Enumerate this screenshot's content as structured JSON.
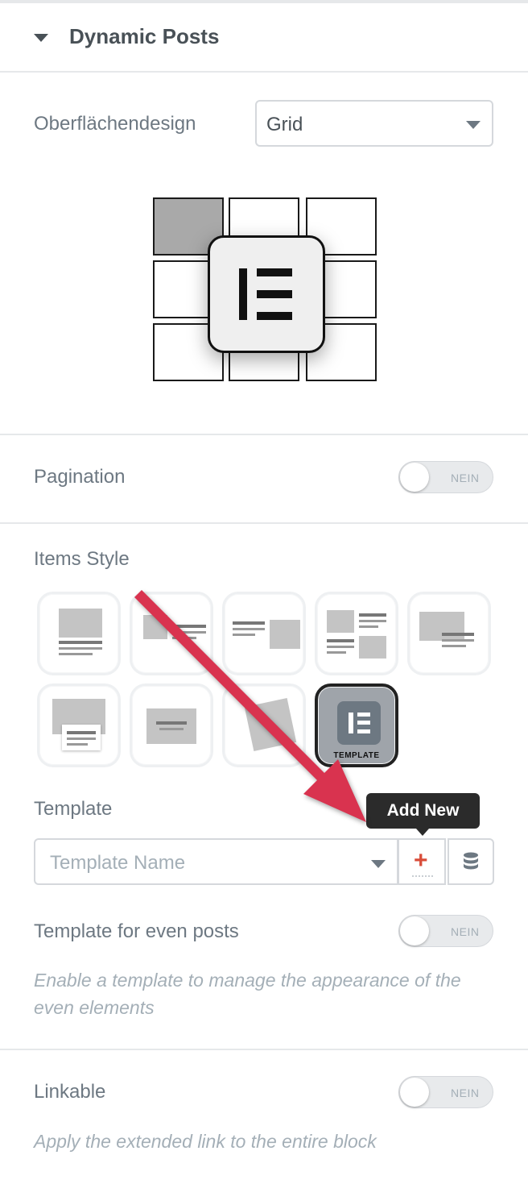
{
  "section": {
    "title": "Dynamic Posts"
  },
  "surface_design": {
    "label": "Oberflächendesign",
    "value": "Grid"
  },
  "pagination": {
    "label": "Pagination",
    "toggle_text": "NEIN"
  },
  "items_style": {
    "label": "Items Style",
    "template_badge": "TEMPLATE"
  },
  "template": {
    "label": "Template",
    "placeholder": "Template Name",
    "add_icon": "+",
    "tooltip": "Add New",
    "library_icon": "database-icon"
  },
  "even_posts": {
    "label": "Template for even posts",
    "toggle_text": "NEIN",
    "description": "Enable a template to manage the appearance of the even elements"
  },
  "linkable": {
    "label": "Linkable",
    "toggle_text": "NEIN",
    "description": "Apply the extended link to the entire block"
  },
  "colors": {
    "annotation_arrow": "#d9334f",
    "add_icon": "#d94d3a"
  }
}
